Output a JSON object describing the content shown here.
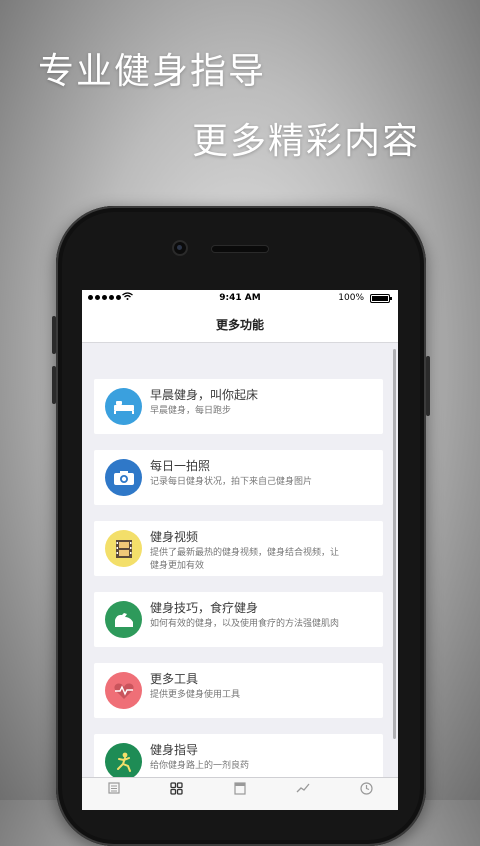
{
  "promo": {
    "headline_1": "专业健身指导",
    "headline_2": "更多精彩内容"
  },
  "status_bar": {
    "time": "9:41 AM",
    "battery": "100%"
  },
  "nav": {
    "title": "更多功能"
  },
  "items": [
    {
      "title": "早晨健身，叫你起床",
      "desc": "早晨健身，每日跑步",
      "icon": "bed-icon",
      "color": "#3aa0de"
    },
    {
      "title": "每日一拍照",
      "desc": "记录每日健身状况，拍下来自己健身图片",
      "icon": "camera-icon",
      "color": "#2f78c8"
    },
    {
      "title": "健身视频",
      "desc": "提供了最新最热的健身视频，健身结合视频，让健身更加有效",
      "icon": "film-icon",
      "color": "#f3df6a"
    },
    {
      "title": "健身技巧，食疗健身",
      "desc": "如何有效的健身，以及使用食疗的方法强健肌肉",
      "icon": "muscle-icon",
      "color": "#2e9a5b"
    },
    {
      "title": "更多工具",
      "desc": "提供更多健身使用工具",
      "icon": "heart-icon",
      "color": "#ef6f77"
    },
    {
      "title": "健身指导",
      "desc": "给你健身路上的一剂良药",
      "icon": "exercise-icon",
      "color": "#1e8c55"
    }
  ],
  "tabs": [
    {
      "icon": "list-icon",
      "active": false
    },
    {
      "icon": "grid-icon",
      "active": true
    },
    {
      "icon": "document-icon",
      "active": false
    },
    {
      "icon": "chart-icon",
      "active": false
    },
    {
      "icon": "clock-icon",
      "active": false
    }
  ]
}
